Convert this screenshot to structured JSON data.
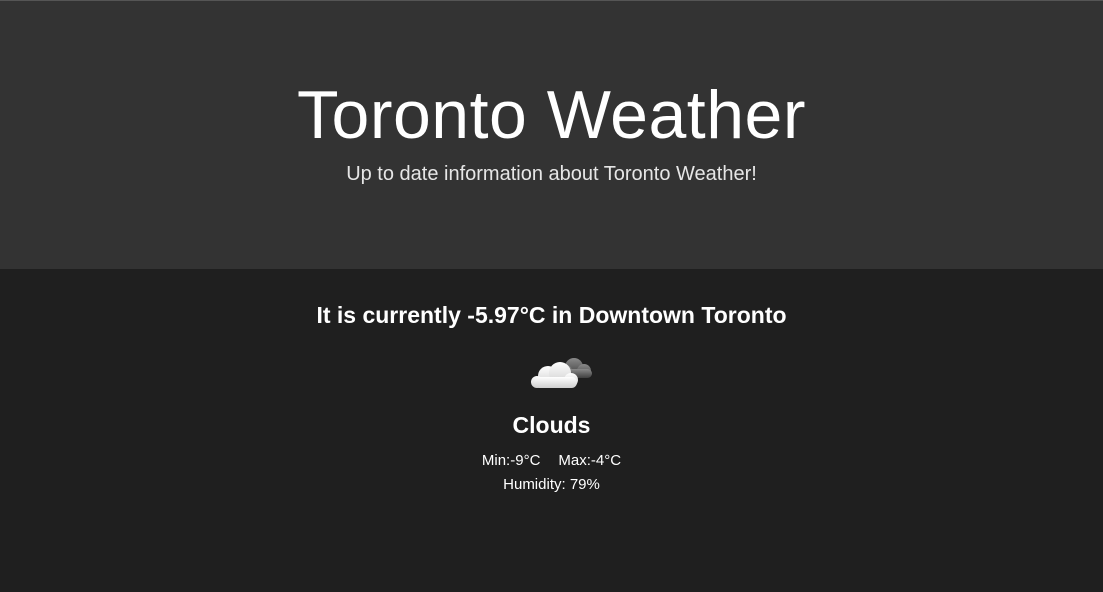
{
  "header": {
    "title": "Toronto Weather",
    "subtitle": "Up to date information about Toronto Weather!"
  },
  "current": {
    "prefix": "It is currently ",
    "temperature": "-5.97°C",
    "suffix": " in Downtown Toronto",
    "icon": "clouds-icon",
    "condition": "Clouds",
    "min_label": "Min: ",
    "min_value": "-9°C",
    "max_label": "Max: ",
    "max_value": "-4°C",
    "humidity_label": "Humidity: ",
    "humidity_value": "79%"
  },
  "colors": {
    "header_bg": "#333333",
    "main_bg": "#1f1f1f",
    "text": "#ffffff"
  }
}
